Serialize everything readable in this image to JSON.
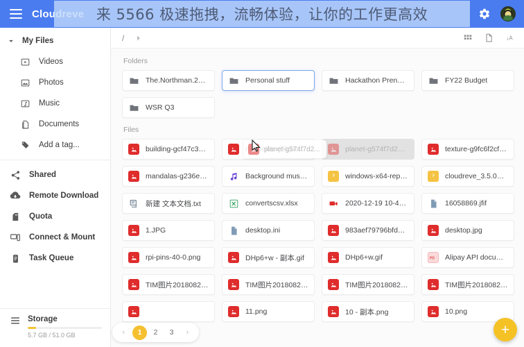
{
  "appbar": {
    "brand": "Cloudreve",
    "menu_icon": "hamburger-icon",
    "settings_icon": "gear-icon",
    "avatar_icon": "user-avatar"
  },
  "promo": {
    "text": "来 5566 极速拖拽，流畅体验，让你的工作更高效"
  },
  "sidebar": {
    "root": {
      "label": "My Files",
      "chevron": "chevron-down-icon"
    },
    "file_types": [
      {
        "label": "Videos",
        "icon": "video-icon"
      },
      {
        "label": "Photos",
        "icon": "photo-icon"
      },
      {
        "label": "Music",
        "icon": "music-icon"
      },
      {
        "label": "Documents",
        "icon": "document-icon"
      },
      {
        "label": "Add a tag...",
        "icon": "tag-icon"
      }
    ],
    "sections": [
      {
        "label": "Shared",
        "icon": "share-icon"
      },
      {
        "label": "Remote Download",
        "icon": "cloud-download-icon"
      },
      {
        "label": "Quota",
        "icon": "sd-card-icon"
      },
      {
        "label": "Connect & Mount",
        "icon": "monitor-icon"
      },
      {
        "label": "Task Queue",
        "icon": "clipboard-icon"
      }
    ],
    "storage": {
      "label": "Storage",
      "icon": "storage-icon",
      "used_text": "5.7 GB / 51.0 GB",
      "percent": 11
    }
  },
  "toolbar": {
    "breadcrumb_root": "/",
    "breadcrumb_chevron": "chevron-right-icon",
    "actions": [
      {
        "name": "grid-view-icon",
        "label": "grid"
      },
      {
        "name": "new-file-icon",
        "label": "new"
      },
      {
        "name": "sort-az-icon",
        "label": "sort"
      }
    ]
  },
  "content": {
    "folders_label": "Folders",
    "files_label": "Files",
    "folders": [
      {
        "name": "The.Northman.2022....",
        "icon": "folder-icon",
        "state": "normal"
      },
      {
        "name": "Personal stuff",
        "icon": "folder-icon",
        "state": "droptarget"
      },
      {
        "name": "Hackathon Prensent...",
        "icon": "folder-icon",
        "state": "normal"
      },
      {
        "name": "FY22 Budget",
        "icon": "folder-icon",
        "state": "normal"
      },
      {
        "name": "WSR Q3",
        "icon": "folder-icon",
        "state": "normal"
      }
    ],
    "files": [
      {
        "name": "building-gcf47c333...",
        "icon": "image-icon",
        "state": "normal"
      },
      {
        "name": "marseille-gf9cdc5ae...",
        "icon": "image-icon",
        "state": "normal"
      },
      {
        "name": "planet-g574f7d288_...",
        "icon": "image-icon",
        "state": "dimmed"
      },
      {
        "name": "texture-g9fc6f2cf9_...",
        "icon": "image-icon",
        "state": "normal"
      },
      {
        "name": "mandalas-g236e1b8...",
        "icon": "image-icon",
        "state": "normal"
      },
      {
        "name": "Background music c...",
        "icon": "audio-icon",
        "state": "normal"
      },
      {
        "name": "windows-x64-repair...",
        "icon": "archive-icon",
        "state": "normal"
      },
      {
        "name": "cloudreve_3.5.0_win...",
        "icon": "archive-icon",
        "state": "normal"
      },
      {
        "name": "新建 文本文档.txt",
        "icon": "text-icon",
        "state": "normal"
      },
      {
        "name": "convertscsv.xlsx",
        "icon": "sheet-icon",
        "state": "normal"
      },
      {
        "name": "2020-12-19 10-46-3...",
        "icon": "video-icon",
        "state": "normal"
      },
      {
        "name": "16058869.jfif",
        "icon": "doc-icon",
        "state": "normal"
      },
      {
        "name": "1.JPG",
        "icon": "image-icon",
        "state": "normal"
      },
      {
        "name": "desktop.ini",
        "icon": "doc-icon",
        "state": "normal"
      },
      {
        "name": "983aef79796bfde83...",
        "icon": "image-icon",
        "state": "normal"
      },
      {
        "name": "desktop.jpg",
        "icon": "image-icon",
        "state": "normal"
      },
      {
        "name": "rpi-pins-40-0.png",
        "icon": "image-icon",
        "state": "normal"
      },
      {
        "name": "DHp6+w - 副本.gif",
        "icon": "image-icon",
        "state": "normal"
      },
      {
        "name": "DHp6+w.gif",
        "icon": "image-icon",
        "state": "normal"
      },
      {
        "name": "Alipay API documen...",
        "icon": "pdf-icon",
        "state": "normal"
      },
      {
        "name": "TIM图片201808221...",
        "icon": "image-icon",
        "state": "normal"
      },
      {
        "name": "TIM图片201808221...",
        "icon": "image-icon",
        "state": "normal"
      },
      {
        "name": "TIM图片201808221...",
        "icon": "image-icon",
        "state": "normal"
      },
      {
        "name": "TIM图片201808221...",
        "icon": "image-icon",
        "state": "normal"
      },
      {
        "name": "",
        "icon": "image-icon",
        "state": "normal"
      },
      {
        "name": "11.png",
        "icon": "image-icon",
        "state": "normal"
      },
      {
        "name": "10 - 副本.png",
        "icon": "image-icon",
        "state": "normal"
      },
      {
        "name": "10.png",
        "icon": "image-icon",
        "state": "normal"
      }
    ],
    "drag_ghost": {
      "name": "planet-g574f7d2...",
      "icon": "image-icon"
    }
  },
  "pagination": {
    "prev": "‹",
    "next": "›",
    "pages": [
      "1",
      "2",
      "3"
    ],
    "current": "1"
  },
  "fab": {
    "label": "+",
    "icon": "add-icon"
  },
  "colors": {
    "appbar": "#4a7cf0",
    "accent_yellow": "#f5c226",
    "image_icon": "#df2c2c",
    "drop_border": "#7fa5e8"
  }
}
